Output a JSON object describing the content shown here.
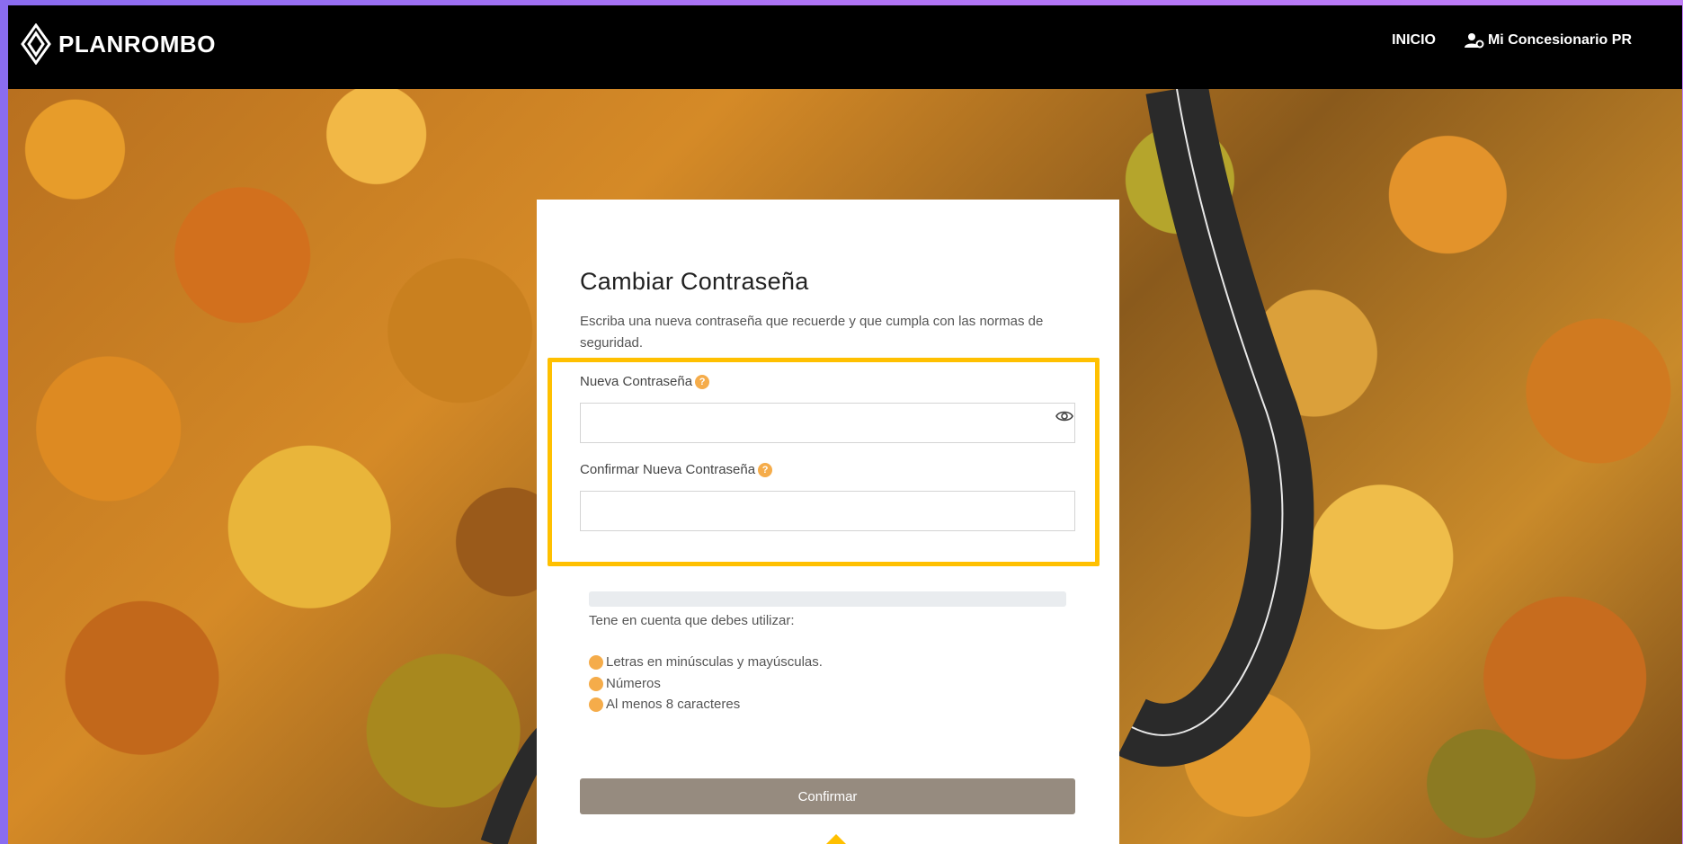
{
  "header": {
    "brand": "PLANROMBO",
    "nav": [
      {
        "label": "INICIO"
      },
      {
        "label": "Mi Concesionario PR"
      }
    ]
  },
  "card": {
    "title": "Cambiar Contraseña",
    "description": "Escriba una nueva contraseña que recuerde y que cumpla con las normas de seguridad.",
    "new_password": {
      "label": "Nueva Contraseña",
      "value": "",
      "help": "?"
    },
    "confirm_password": {
      "label": "Confirmar Nueva Contraseña",
      "value": "",
      "help": "?"
    },
    "note": "Tene en cuenta que debes utilizar:",
    "requirements": [
      "Letras en minúsculas y mayúsculas.",
      "Números",
      "Al menos 8 caracteres"
    ],
    "confirm_label": "Confirmar"
  },
  "colors": {
    "header_bg": "#000000",
    "highlight": "#ffc000",
    "help_dot": "#f5ac4a",
    "button": "#968b7f",
    "strength_bar": "#e9ecef"
  }
}
